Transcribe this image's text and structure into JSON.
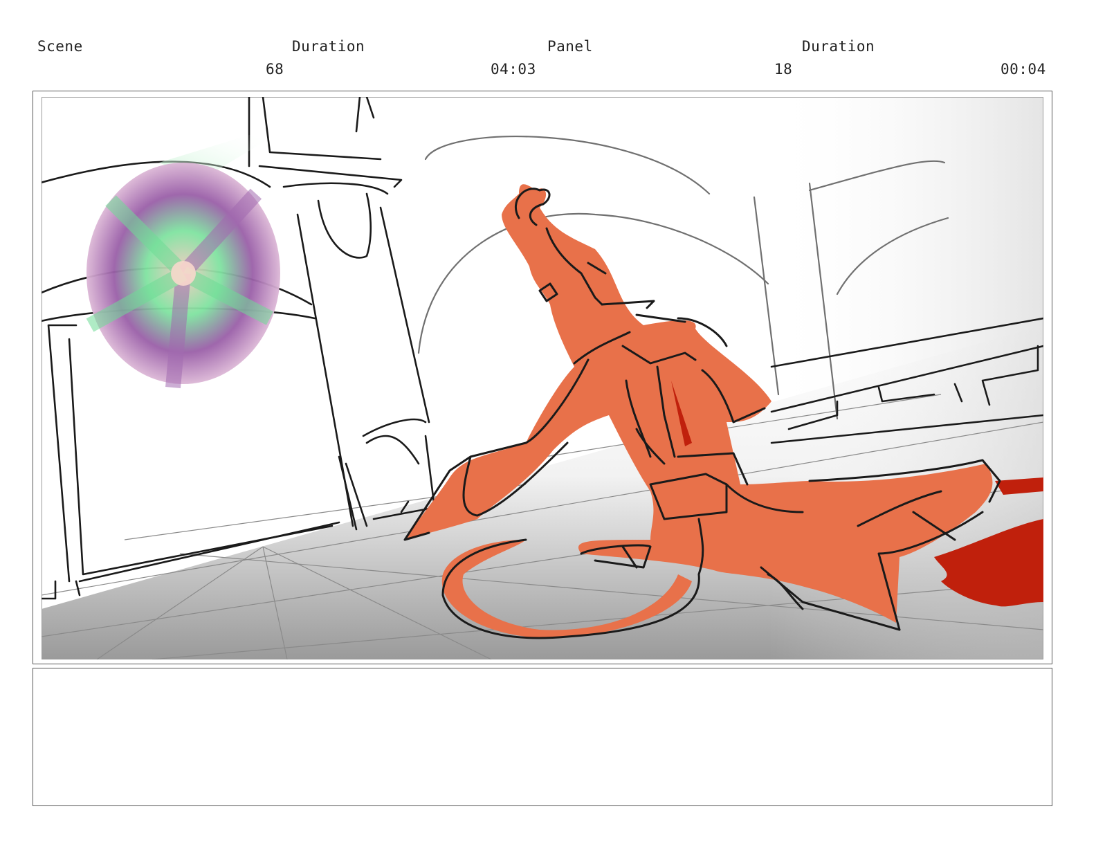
{
  "header": {
    "labels": {
      "scene": "Scene",
      "scene_duration": "Duration",
      "panel": "Panel",
      "panel_duration": "Duration"
    },
    "values": {
      "scene_number": "68",
      "scene_duration": "04:03",
      "panel_number": "18",
      "panel_duration": "00:04"
    }
  },
  "artwork": {
    "character_color": "#e8714a",
    "blood_color": "#c0200c",
    "line_color": "#1a1a1a",
    "guide_color": "#8a8a8a"
  },
  "notes": {
    "text": ""
  }
}
